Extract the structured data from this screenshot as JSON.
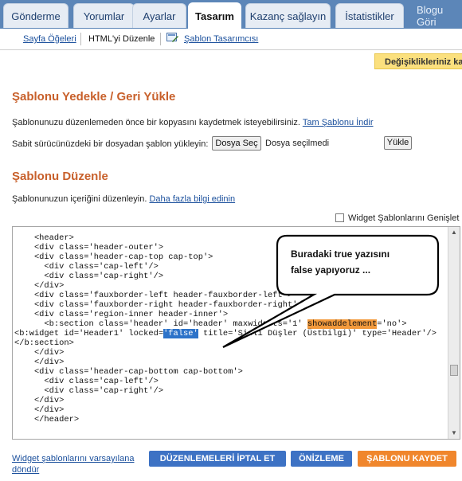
{
  "tabs": [
    {
      "label": "Gönderme"
    },
    {
      "label": "Yorumlar"
    },
    {
      "label": "Ayarlar"
    },
    {
      "label": "Tasarım"
    },
    {
      "label": "Kazanç sağlayın"
    },
    {
      "label": "İstatistikler"
    },
    {
      "label": "Blogu Göri"
    }
  ],
  "subnav": {
    "page_elements": "Sayfa Öğeleri",
    "edit_html": "HTML'yi Düzenle",
    "template_designer": "Şablon Tasarımcısı"
  },
  "notice": "Değişiklikleriniz ka",
  "backup": {
    "heading": "Şablonu Yedekle / Geri Yükle",
    "desc": "Şablonunuzu düzenlemeden önce bir kopyasını kaydetmek isteyebilirsiniz.",
    "download_link": "Tam Şablonu İndir",
    "upload_label": "Sabit sürücünüzdeki bir dosyadan şablon yükleyin:",
    "choose_file": "Dosya Seç",
    "no_file": "Dosya seçilmedi",
    "upload_button": "Yükle"
  },
  "edit": {
    "heading": "Şablonu Düzenle",
    "desc": "Şablonunuzun içeriğini düzenleyin.",
    "more_info_link": "Daha fazla bilgi edinin",
    "expand_widgets": "Widget Şablonlarını Genişlet"
  },
  "code_lines": [
    "    <header>",
    "    <div class='header-outer'>",
    "    <div class='header-cap-top cap-top'>",
    "      <div class='cap-left'/>",
    "      <div class='cap-right'/>",
    "    </div>",
    "    <div class='fauxborder-left header-fauxborder-left'>",
    "    <div class='fauxborder-right header-fauxborder-right'/>",
    "    <div class='region-inner header-inner'>",
    "      <b:section class='header' id='header' maxwidgets='1' showaddelement='no'>",
    "<b:widget id='Header1' locked='false' title='Sisli Düşler (Üstbilgi)' type='Header'/>",
    "</b:section>",
    "    </div>",
    "    </div>",
    "    <div class='header-cap-bottom cap-bottom'>",
    "      <div class='cap-left'/>",
    "      <div class='cap-right'/>",
    "    </div>",
    "    </div>",
    "    </header>"
  ],
  "annotation": {
    "line1": "Buradaki true yazısını",
    "line2": "false yapıyoruz ..."
  },
  "footer": {
    "reset_link": "Widget şablonlarını varsayılana döndür",
    "cancel": "DÜZENLEMELERİ İPTAL ET",
    "preview": "ÖNİZLEME",
    "save": "ŞABLONU KAYDET"
  },
  "colors": {
    "tabbar": "#5c86b8",
    "heading": "#c8602b",
    "cancel_btn": "#3d72c4",
    "preview_btn": "#3d72c4",
    "save_btn": "#f0862c",
    "notice_bg": "#fbe07e",
    "highlight_false": "#2d73c9",
    "highlight_showaddelement": "#f39a3c"
  }
}
